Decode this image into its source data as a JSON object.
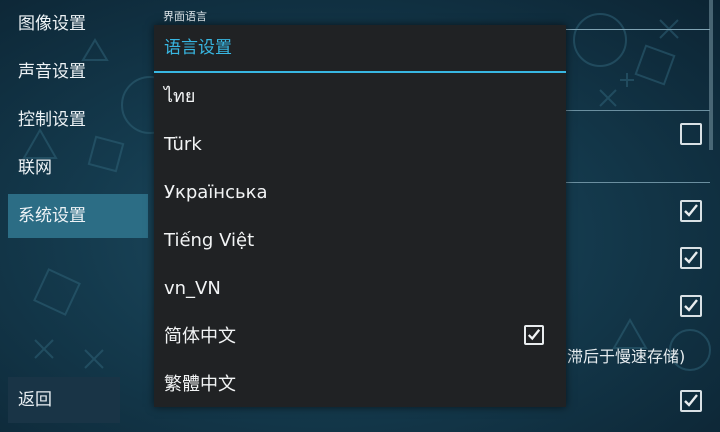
{
  "sidebar": {
    "items": [
      {
        "label": "图像设置",
        "selected": false
      },
      {
        "label": "声音设置",
        "selected": false
      },
      {
        "label": "控制设置",
        "selected": false
      },
      {
        "label": "联网",
        "selected": false
      },
      {
        "label": "系统设置",
        "selected": true
      }
    ],
    "back_label": "返回"
  },
  "settings_background": {
    "section_label": "界面语言",
    "partial_text": "滞后于慢速存储)",
    "checkbox_states": [
      false,
      true,
      true,
      true,
      true
    ]
  },
  "dialog": {
    "title": "语言设置",
    "languages": [
      {
        "label": "ไทย",
        "checked": false
      },
      {
        "label": "Türk",
        "checked": false
      },
      {
        "label": "Українська",
        "checked": false
      },
      {
        "label": "Tiếng Việt",
        "checked": false
      },
      {
        "label": "vn_VN",
        "checked": false
      },
      {
        "label": "简体中文",
        "checked": true
      },
      {
        "label": "繁體中文",
        "checked": false
      }
    ]
  },
  "colors": {
    "accent": "#38b7e2",
    "dialog_bg": "#202224",
    "sidebar_selected": "#2c6d85"
  }
}
